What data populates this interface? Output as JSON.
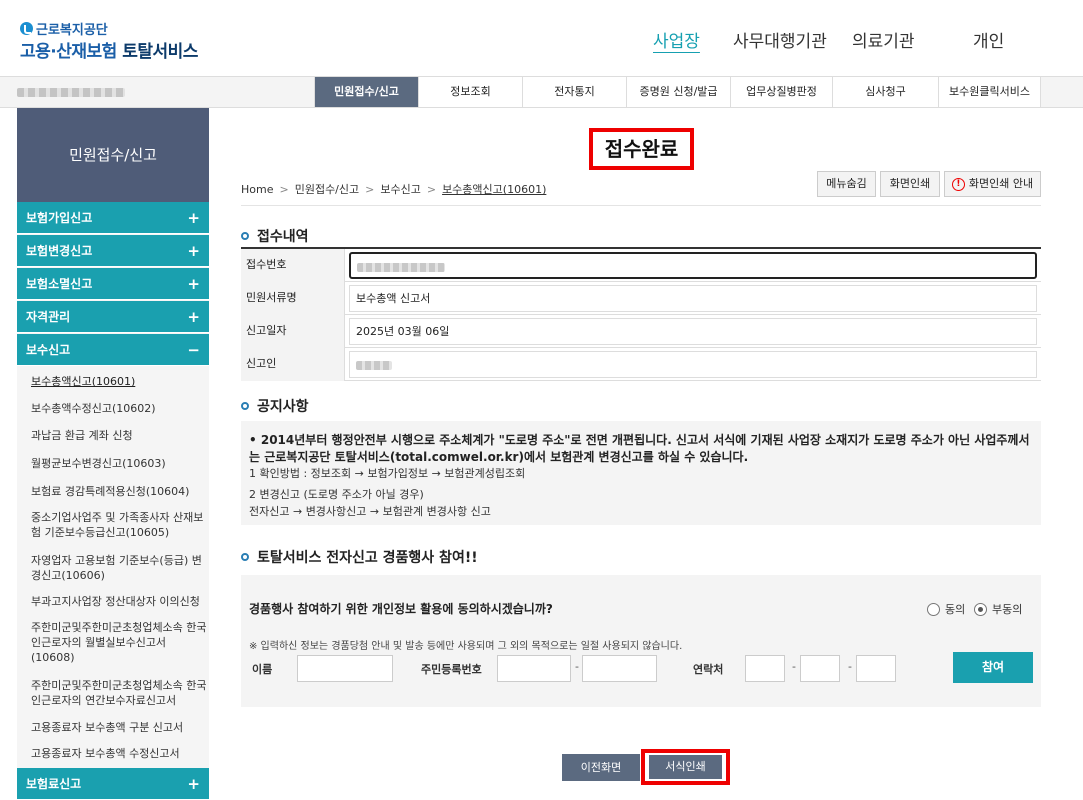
{
  "header": {
    "logo_top": "근로복지공단",
    "logo_main_a": "고용·산재보험",
    "logo_main_b": "토탈서비스",
    "nav": [
      "사업장",
      "사무대행기관",
      "의료기관",
      "개인"
    ],
    "active_nav": "사업장"
  },
  "gnb": {
    "items": [
      "민원접수/신고",
      "정보조회",
      "전자통지",
      "증명원 신청/발급",
      "업무상질병판정",
      "심사청구",
      "보수원클릭서비스"
    ],
    "active": "민원접수/신고"
  },
  "sidebar": {
    "title": "민원접수/신고",
    "categories": [
      {
        "label": "보험가입신고",
        "sign": "+"
      },
      {
        "label": "보험변경신고",
        "sign": "+"
      },
      {
        "label": "보험소멸신고",
        "sign": "+"
      },
      {
        "label": "자격관리",
        "sign": "+"
      },
      {
        "label": "보수신고",
        "sign": "−"
      }
    ],
    "sub_items": [
      "보수총액신고(10601)",
      "보수총액수정신고(10602)",
      "과납금 환급 계좌 신청",
      "월평균보수변경신고(10603)",
      "보험료 경감특례적용신청(10604)",
      "중소기업사업주 및 가족종사자 산재보험 기준보수등급신고(10605)",
      "자영업자 고용보험 기준보수(등급) 변경신고(10606)",
      "부과고지사업장 정산대상자 이의신청",
      "주한미군및주한미군초청업체소속 한국인근로자의 월별실보수신고서 (10608)",
      "주한미군및주한미군초청업체소속 한국인근로자의 연간보수자료신고서",
      "고용종료자 보수총액 구분 신고서",
      "고용종료자 보수총액 수정신고서"
    ],
    "bottom_category": {
      "label": "보험료신고",
      "sign": "+"
    }
  },
  "main": {
    "page_title": "접수완료",
    "breadcrumb": [
      "Home",
      "민원접수/신고",
      "보수신고",
      "보수총액신고(10601)"
    ],
    "buttons": {
      "hide_menu": "메뉴숨김",
      "print_screen": "화면인쇄",
      "print_guide": "화면인쇄 안내"
    },
    "receipt_title": "접수내역",
    "receipt": [
      {
        "label": "접수번호",
        "value": ""
      },
      {
        "label": "민원서류명",
        "value": "보수총액 신고서"
      },
      {
        "label": "신고일자",
        "value": "2025년 03월 06일"
      },
      {
        "label": "신고인",
        "value": ""
      }
    ],
    "notice_title": "공지사항",
    "notice_main": "• 2014년부터 행정안전부 시행으로 주소체계가 \"도로명 주소\"로 전면 개편됩니다. 신고서 서식에 기재된 사업장 소재지가 도로명 주소가 아닌 사업주께서는 근로복지공단 토탈서비스(total.comwel.or.kr)에서 보험관계 변경신고를 하실 수 있습니다.",
    "notice_lines": [
      "1 확인방법 : 정보조회 → 보험가입정보 → 보험관계성립조회",
      "2 변경신고 (도로명 주소가 아닐 경우)",
      "전자신고 → 변경사항신고 → 보험관계 변경사항 신고"
    ],
    "event_title": "토탈서비스 전자신고 경품행사 참여!!",
    "event_question": "경품행사 참여하기 위한 개인정보 활용에 동의하시겠습니까?",
    "radio_agree": "동의",
    "radio_disagree": "부동의",
    "radio_selected": "부동의",
    "event_note": "※  입력하신 정보는 경품당첨 안내 및 발송 등에만 사용되며 그 외의 목적으로는 일절 사용되지 않습니다.",
    "field_name": "이름",
    "field_rrn": "주민등록번호",
    "field_contact": "연락처",
    "join_button": "참여",
    "prev_button": "이전화면",
    "print_button": "서식인쇄"
  }
}
